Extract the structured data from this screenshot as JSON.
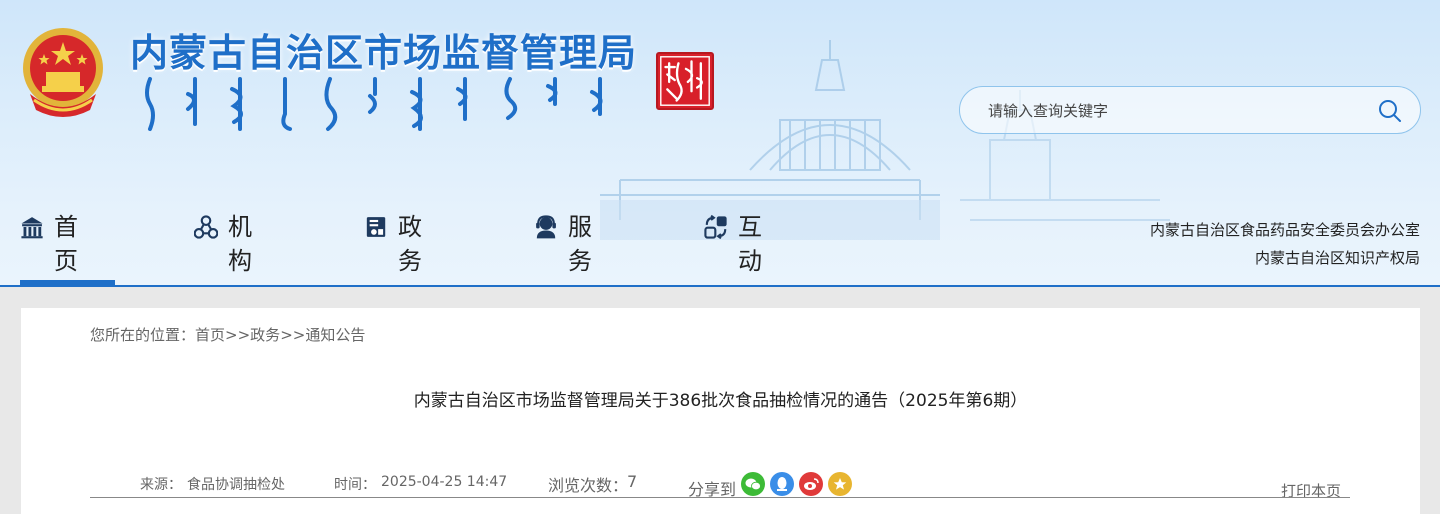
{
  "site": {
    "title": "内蒙古自治区市场监督管理局",
    "emblem_icon": "national-emblem-icon",
    "seal_icon": "mongolian-seal-icon"
  },
  "search": {
    "placeholder": "请输入查询关键字",
    "value": ""
  },
  "nav": {
    "items": [
      {
        "label": "首页",
        "icon": "home-building-icon",
        "active": true
      },
      {
        "label": "机构",
        "icon": "organization-icon",
        "active": false
      },
      {
        "label": "政务",
        "icon": "government-affairs-icon",
        "active": false
      },
      {
        "label": "服务",
        "icon": "service-agent-icon",
        "active": false
      },
      {
        "label": "互动",
        "icon": "interaction-icon",
        "active": false
      }
    ]
  },
  "right_links": [
    "内蒙古自治区食品药品安全委员会办公室",
    "内蒙古自治区知识产权局"
  ],
  "breadcrumb": {
    "prefix": "您所在的位置：",
    "items": [
      "首页",
      "政务",
      "通知公告"
    ],
    "separator": ">>"
  },
  "article": {
    "title": "内蒙古自治区市场监督管理局关于386批次食品抽检情况的通告（2025年第6期）",
    "source_label": "来源：",
    "source": "食品协调抽检处",
    "time_label": "时间：",
    "time": "2025-04-25 14:47",
    "views_label": "浏览次数：",
    "views": "7",
    "share_label": "分享到",
    "print_label": "打印本页"
  },
  "colors": {
    "brand_blue": "#1f6fc8",
    "wechat_green": "#3dbb37",
    "qq_blue": "#3a8ee8",
    "weibo_red": "#e03a3a",
    "qzone_yellow": "#e8b530"
  }
}
